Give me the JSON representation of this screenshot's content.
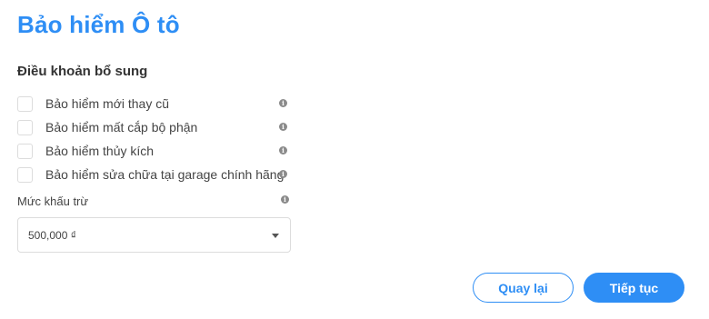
{
  "page": {
    "title": "Bảo hiểm Ô tô",
    "section_title": "Điều khoản bổ sung"
  },
  "options": [
    {
      "label": "Bảo hiểm mới thay cũ",
      "checked": false
    },
    {
      "label": "Bảo hiểm mất cắp bộ phận",
      "checked": false
    },
    {
      "label": "Bảo hiểm thủy kích",
      "checked": false
    },
    {
      "label": "Bảo hiểm sửa chữa tại garage chính hãng",
      "checked": false
    }
  ],
  "deductible": {
    "label": "Mức khấu trừ",
    "selected": "500,000 ₫"
  },
  "buttons": {
    "back": "Quay lại",
    "next": "Tiếp tục"
  },
  "icons": {
    "info": "i"
  },
  "colors": {
    "accent": "#2e8ef5",
    "text": "#333333",
    "border": "#dcdcdc"
  }
}
